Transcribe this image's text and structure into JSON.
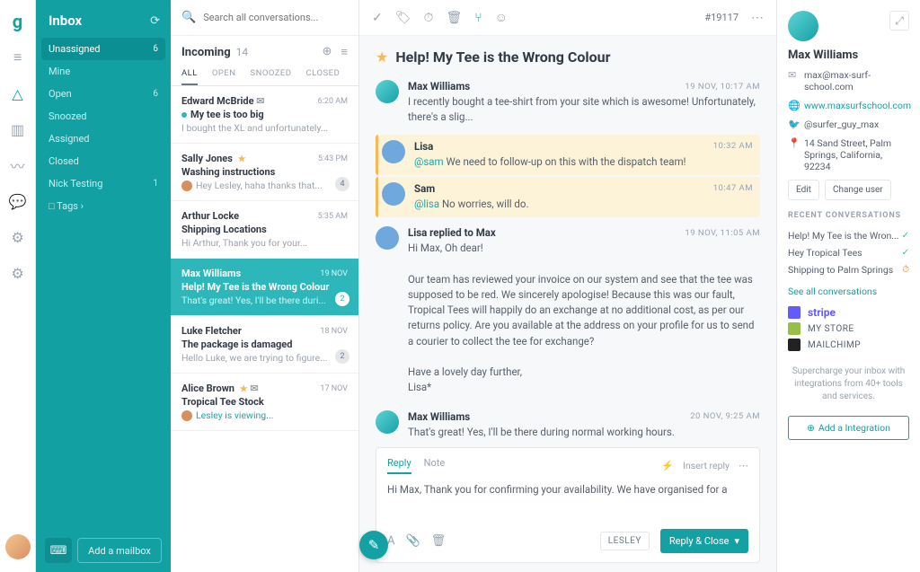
{
  "sidebar": {
    "title": "Inbox",
    "items": [
      {
        "label": "Unassigned",
        "count": "6",
        "active": true
      },
      {
        "label": "Mine",
        "count": ""
      },
      {
        "label": "Open",
        "count": "6"
      },
      {
        "label": "Snoozed",
        "count": ""
      },
      {
        "label": "Assigned",
        "count": ""
      },
      {
        "label": "Closed",
        "count": ""
      },
      {
        "label": "Nick Testing",
        "count": "1"
      },
      {
        "label": "□ Tags  ›",
        "count": ""
      }
    ],
    "add_mailbox": "Add a mailbox"
  },
  "search": {
    "placeholder": "Search all conversations..."
  },
  "list": {
    "heading": "Incoming",
    "count": "14",
    "tabs": [
      "ALL",
      "OPEN",
      "SNOOZED",
      "CLOSED"
    ],
    "items": [
      {
        "name": "Edward McBride",
        "time": "6:20 AM",
        "subject": "My tee is too big",
        "preview": "I bought the XL and unfortunately...",
        "unread": true,
        "source": true
      },
      {
        "name": "Sally Jones",
        "time": "5:43 PM",
        "subject": "Washing instructions",
        "preview": "Hey Lesley, haha thanks that...",
        "star": true,
        "badge": "4",
        "avatar": true
      },
      {
        "name": "Arthur Locke",
        "time": "5:35 AM",
        "subject": "Shipping Locations",
        "preview": "Hi Arthur, Thank you for your..."
      },
      {
        "name": "Max Williams",
        "time": "19 NOV",
        "subject": "Help! My Tee is the Wrong Colour",
        "preview": "That's great! Yes, I'll be there duri...",
        "active": true,
        "badge": "2"
      },
      {
        "name": "Luke Fletcher",
        "time": "18 NOV",
        "subject": "The package is damaged",
        "preview": "Hello Luke, we are trying to figure...",
        "badge": "2"
      },
      {
        "name": "Alice Brown",
        "time": "17 NOV",
        "subject": "Tropical Tee Stock",
        "preview": "Lesley is viewing...",
        "star": true,
        "source": true,
        "avatar": true,
        "viewing": true
      }
    ]
  },
  "thread": {
    "ticket": "#19117",
    "title": "Help! My Tee is the Wrong Colour",
    "messages": [
      {
        "who": "Max Williams",
        "ts": "19 NOV, 10:17 AM",
        "txt": "I recently bought a tee-shirt from your site which is awesome! Unfortunately, there's a slig...",
        "av": "max"
      },
      {
        "who": "Lisa",
        "ts": "10:32 AM",
        "txt": "@sam We need to follow-up on this with the dispatch team!",
        "note": true,
        "av": "blue"
      },
      {
        "who": "Sam",
        "ts": "10:47 AM",
        "txt": "@lisa No worries, will do.",
        "note": true,
        "av": "blue"
      },
      {
        "who": "Lisa replied to Max",
        "ts": "19 NOV, 11:05 AM",
        "txt": "Hi Max, Oh dear!\n\nOur team has reviewed your invoice on our system and see that the tee was supposed to be red. We sincerely apologise! Because this was our fault, Tropical Tees will happily do an exchange at no additional cost, as per our returns policy. Are you available at the address on your profile for us to send a courier to collect the tee for exchange?\n\nHave a lovely day further,\nLisa*",
        "av": "blue"
      },
      {
        "who": "Max Williams",
        "ts": "20 NOV, 9:25 AM",
        "txt": "That's great! Yes, I'll be there during normal working hours.\n\nThanks again,\nMax",
        "av": "max"
      }
    ]
  },
  "composer": {
    "tabs": {
      "reply": "Reply",
      "note": "Note"
    },
    "insert": "Insert reply",
    "draft": "Hi Max, Thank you for confirming your availability. We have organised for a",
    "assignee": "LESLEY",
    "send": "Reply & Close"
  },
  "profile": {
    "name": "Max Williams",
    "email": "max@max-surf-school.com",
    "website": "www.maxsurfschool.com",
    "twitter": "@surfer_guy_max",
    "address": "14 Sand Street, Palm Springs, California, 92234",
    "edit": "Edit",
    "change": "Change user",
    "recent_heading": "RECENT CONVERSATIONS",
    "recent": [
      {
        "t": "Help! My Tee is the Wron...",
        "ok": true
      },
      {
        "t": "Hey Tropical Tees",
        "ok": true
      },
      {
        "t": "Shipping to Palm Springs",
        "ok": false
      }
    ],
    "seeall": "See all conversations",
    "intg": [
      {
        "t": "stripe",
        "color": "#635bff",
        "bold": true
      },
      {
        "t": "MY STORE",
        "color": "#95bf47"
      },
      {
        "t": "MAILCHIMP",
        "color": "#222"
      }
    ],
    "promo": "Supercharge your inbox with integrations from 40+ tools and services.",
    "add": "Add a Integration"
  }
}
